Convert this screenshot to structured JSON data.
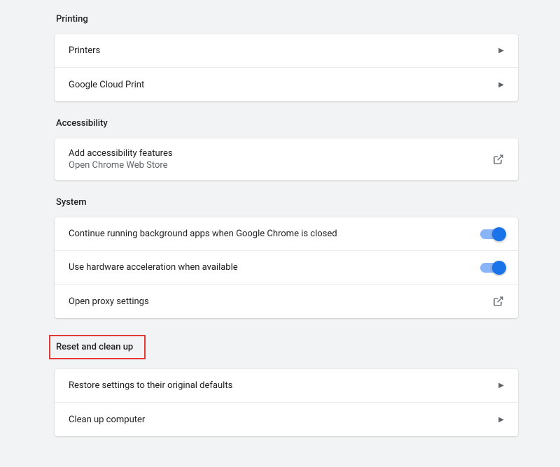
{
  "printing": {
    "title": "Printing",
    "items": [
      {
        "label": "Printers"
      },
      {
        "label": "Google Cloud Print"
      }
    ]
  },
  "accessibility": {
    "title": "Accessibility",
    "items": [
      {
        "label": "Add accessibility features",
        "sublabel": "Open Chrome Web Store"
      }
    ]
  },
  "system": {
    "title": "System",
    "items": [
      {
        "label": "Continue running background apps when Google Chrome is closed"
      },
      {
        "label": "Use hardware acceleration when available"
      },
      {
        "label": "Open proxy settings"
      }
    ]
  },
  "reset": {
    "title": "Reset and clean up",
    "items": [
      {
        "label": "Restore settings to their original defaults"
      },
      {
        "label": "Clean up computer"
      }
    ]
  }
}
